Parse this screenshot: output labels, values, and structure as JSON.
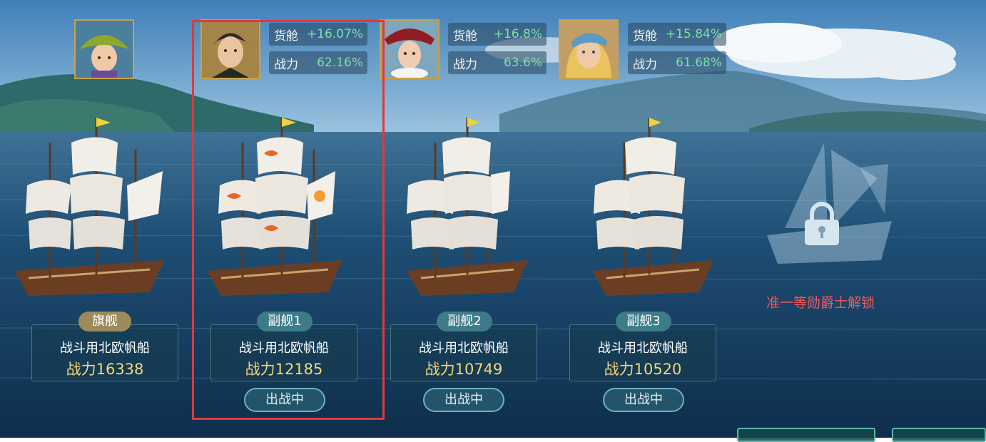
{
  "captains": [
    {
      "icon": "captain-green-hat-icon"
    },
    {
      "icon": "captain-black-hair-icon",
      "cargo_label": "货舱",
      "cargo_value": "+16.07%",
      "power_label": "战力",
      "power_value": "62.16%"
    },
    {
      "icon": "captain-red-hat-icon",
      "cargo_label": "货舱",
      "cargo_value": "+16.8%",
      "power_label": "战力",
      "power_value": "63.6%"
    },
    {
      "icon": "captain-blue-bandana-icon",
      "cargo_label": "货舱",
      "cargo_value": "+15.84%",
      "power_label": "战力",
      "power_value": "61.68%"
    }
  ],
  "ships": [
    {
      "tag": "旗舰",
      "name": "战斗用北欧帆船",
      "power": "战力16338",
      "status": ""
    },
    {
      "tag": "副舰1",
      "name": "战斗用北欧帆船",
      "power": "战力12185",
      "status": "出战中"
    },
    {
      "tag": "副舰2",
      "name": "战斗用北欧帆船",
      "power": "战力10749",
      "status": "出战中"
    },
    {
      "tag": "副舰3",
      "name": "战斗用北欧帆船",
      "power": "战力10520",
      "status": "出战中"
    }
  ],
  "locked_slot": {
    "text": "准一等勋爵士解锁",
    "icon": "lock-icon"
  },
  "colors": {
    "gain": "#7ce0a8",
    "power": "#f4d77a",
    "unlock": "#f05a5a",
    "selection": "#e0393b"
  }
}
